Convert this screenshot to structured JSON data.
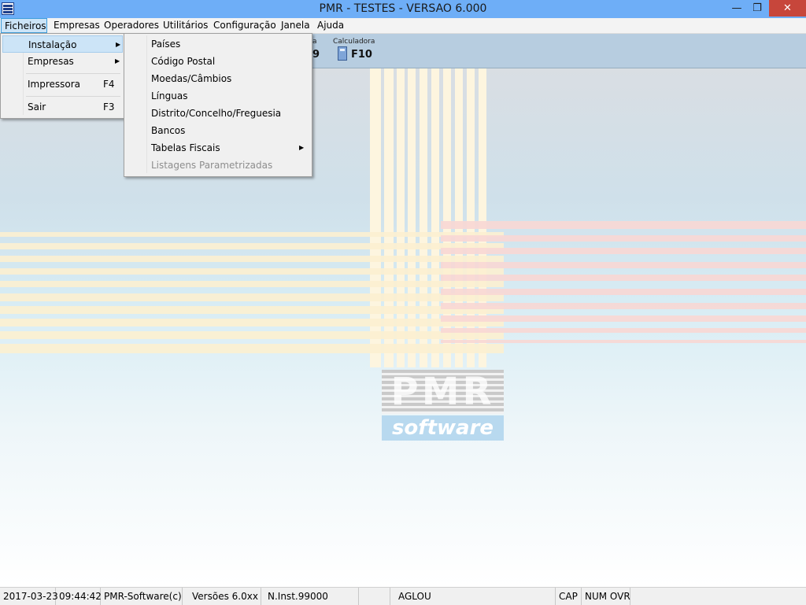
{
  "window": {
    "title": "PMR - TESTES - VERSAO 6.000",
    "minimize_glyph": "—",
    "restore_glyph": "❐",
    "close_glyph": "✕"
  },
  "menubar": {
    "items": [
      "Ficheiros",
      "Empresas",
      "Operadores",
      "Utilitários",
      "Configuração",
      "Janela",
      "Ajuda"
    ]
  },
  "toolbar": {
    "partial_label": "a",
    "partial_key": "9",
    "calculator_label": "Calculadora",
    "calculator_key": "F10"
  },
  "ficheiros_menu": {
    "items": [
      {
        "label": "Instalação",
        "accel": "",
        "submenu": true
      },
      {
        "label": "Empresas",
        "accel": "",
        "submenu": true
      },
      {
        "label": "Impressora",
        "accel": "F4",
        "submenu": false
      },
      {
        "label": "Sair",
        "accel": "F3",
        "submenu": false
      }
    ]
  },
  "instalacao_submenu": {
    "items": [
      {
        "label": "Países"
      },
      {
        "label": "Código Postal"
      },
      {
        "label": "Moedas/Câmbios"
      },
      {
        "label": "Línguas"
      },
      {
        "label": "Distrito/Concelho/Freguesia"
      },
      {
        "label": "Bancos"
      },
      {
        "label": "Tabelas Fiscais"
      },
      {
        "label": "Listagens Parametrizadas"
      }
    ]
  },
  "logo": {
    "top_text": "PMR",
    "bottom_text": "software"
  },
  "statusbar": {
    "date": "2017-03-23",
    "time": "09:44:42",
    "company": "PMR-Software(c)",
    "versions": "Versões 6.0xx",
    "install": "N.Inst.99000",
    "blank": "",
    "user": "AGLOU",
    "cap": "CAP",
    "num_ovr": "NUM OVR"
  },
  "colors": {
    "titlebar": "#6eaef7",
    "menu_highlight": "#cce4f7",
    "close_button": "#c7463b"
  }
}
